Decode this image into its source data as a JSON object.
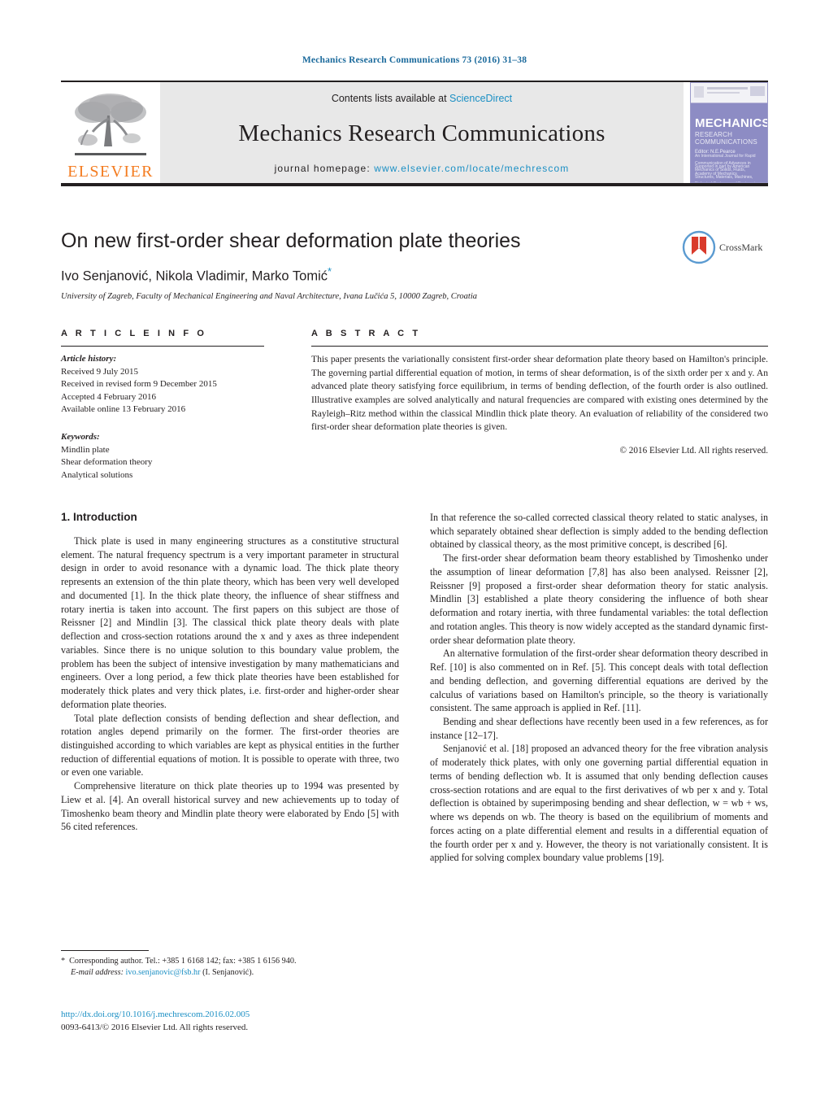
{
  "running_head": "Mechanics Research Communications 73 (2016) 31–38",
  "masthead": {
    "publisher_name": "ELSEVIER",
    "contents_prefix": "Contents lists available at ",
    "contents_link": "ScienceDirect",
    "journal_title": "Mechanics Research Communications",
    "homepage_prefix": "journal homepage: ",
    "homepage_url": "www.elsevier.com/locate/mechrescom",
    "cover": {
      "title": "MECHANICS",
      "subtitle": "RESEARCH COMMUNICATIONS",
      "editor": "Editor: N.E.Pearce",
      "blurb": "An International Journal for Rapid Communication of Advances in Mechanics of Solids, Fluids, Structures, Materials, Machines, Biological Systems and Engineering Processes",
      "footer": "Supported in part by\nAmerican Academy of Mechanics"
    }
  },
  "article": {
    "title": "On new first-order shear deformation plate theories",
    "authors": "Ivo Senjanović, Nikola Vladimir, Marko Tomić",
    "corresponding_marker": "*",
    "affiliation": "University of Zagreb, Faculty of Mechanical Engineering and Naval Architecture, Ivana Lučića 5, 10000 Zagreb, Croatia",
    "crossmark_label": "CrossMark"
  },
  "article_info": {
    "heading": "A R T I C L E   I N F O",
    "history_label": "Article history:",
    "history": [
      "Received 9 July 2015",
      "Received in revised form 9 December 2015",
      "Accepted 4 February 2016",
      "Available online 13 February 2016"
    ],
    "keywords_label": "Keywords:",
    "keywords": [
      "Mindlin plate",
      "Shear deformation theory",
      "Analytical solutions"
    ]
  },
  "abstract": {
    "heading": "A B S T R A C T",
    "text": "This paper presents the variationally consistent first-order shear deformation plate theory based on Hamilton's principle. The governing partial differential equation of motion, in terms of shear deformation, is of the sixth order per x and y. An advanced plate theory satisfying force equilibrium, in terms of bending deflection, of the fourth order is also outlined. Illustrative examples are solved analytically and natural frequencies are compared with existing ones determined by the Rayleigh–Ritz method within the classical Mindlin thick plate theory. An evaluation of reliability of the considered two first-order shear deformation plate theories is given.",
    "copyright": "© 2016 Elsevier Ltd. All rights reserved."
  },
  "body": {
    "section_heading": "1.  Introduction",
    "left_paragraphs": [
      "Thick plate is used in many engineering structures as a constitutive structural element. The natural frequency spectrum is a very important parameter in structural design in order to avoid resonance with a dynamic load. The thick plate theory represents an extension of the thin plate theory, which has been very well developed and documented [1]. In the thick plate theory, the influence of shear stiffness and rotary inertia is taken into account. The first papers on this subject are those of Reissner [2] and Mindlin [3]. The classical thick plate theory deals with plate deflection and cross-section rotations around the x and y axes as three independent variables. Since there is no unique solution to this boundary value problem, the problem has been the subject of intensive investigation by many mathematicians and engineers. Over a long period, a few thick plate theories have been established for moderately thick plates and very thick plates, i.e. first-order and higher-order shear deformation plate theories.",
      "Total plate deflection consists of bending deflection and shear deflection, and rotation angles depend primarily on the former. The first-order theories are distinguished according to which variables are kept as physical entities in the further reduction of differential equations of motion. It is possible to operate with three, two or even one variable.",
      "Comprehensive literature on thick plate theories up to 1994 was presented by Liew et al. [4]. An overall historical survey and new achievements up to today of Timoshenko beam theory and Mindlin plate theory were elaborated by Endo [5] with 56 cited references."
    ],
    "right_paragraphs": [
      "In that reference the so-called corrected classical theory related to static analyses, in which separately obtained shear deflection is simply added to the bending deflection obtained by classical theory, as the most primitive concept, is described [6].",
      "The first-order shear deformation beam theory established by Timoshenko under the assumption of linear deformation [7,8] has also been analysed. Reissner [2], Reissner [9] proposed a first-order shear deformation theory for static analysis. Mindlin [3] established a plate theory considering the influence of both shear deformation and rotary inertia, with three fundamental variables: the total deflection and rotation angles. This theory is now widely accepted as the standard dynamic first-order shear deformation plate theory.",
      "An alternative formulation of the first-order shear deformation theory described in Ref. [10] is also commented on in Ref. [5]. This concept deals with total deflection and bending deflection, and governing differential equations are derived by the calculus of variations based on Hamilton's principle, so the theory is variationally consistent. The same approach is applied in Ref. [11].",
      "Bending and shear deflections have recently been used in a few references, as for instance [12–17].",
      "Senjanović et al. [18] proposed an advanced theory for the free vibration analysis of moderately thick plates, with only one governing partial differential equation in terms of bending deflection wb. It is assumed that only bending deflection causes cross-section rotations and are equal to the first derivatives of wb per x and y. Total deflection is obtained by superimposing bending and shear deflection, w = wb + ws, where ws depends on wb. The theory is based on the equilibrium of moments and forces acting on a plate differential element and results in a differential equation of the fourth order per x and y. However, the theory is not variationally consistent. It is applied for solving complex boundary value problems [19]."
    ]
  },
  "footnote": {
    "marker": "*",
    "corresponding": "Corresponding author. Tel.: +385 1 6168 142; fax: +385 1 6156 940.",
    "email_label": "E-mail address:",
    "email": "ivo.senjanovic@fsb.hr",
    "email_suffix": "(I. Senjanović)."
  },
  "doi": {
    "url": "http://dx.doi.org/10.1016/j.mechrescom.2016.02.005",
    "issn_line": "0093-6413/© 2016 Elsevier Ltd. All rights reserved."
  },
  "colors": {
    "link": "#1b8fc4",
    "runhead": "#1b6a9c",
    "elsevier_orange": "#f47c20",
    "band_gray": "#e8e8e8",
    "cover_purple": "#8d8cc4"
  }
}
